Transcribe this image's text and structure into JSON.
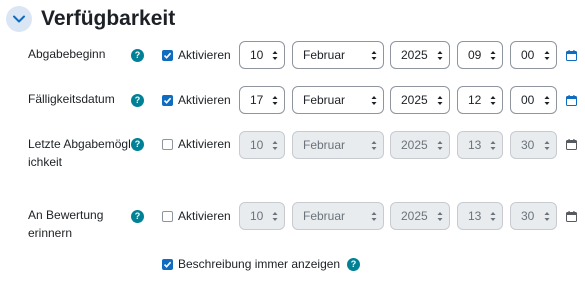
{
  "section": {
    "title": "Verfügbarkeit"
  },
  "rows": [
    {
      "label": "Abgabebeginn",
      "checkbox_label": "Aktivieren",
      "checked": true,
      "day": "10",
      "month": "Februar",
      "year": "2025",
      "hour": "09",
      "minute": "00"
    },
    {
      "label": "Fälligkeitsdatum",
      "checkbox_label": "Aktivieren",
      "checked": true,
      "day": "17",
      "month": "Februar",
      "year": "2025",
      "hour": "12",
      "minute": "00"
    },
    {
      "label": "Letzte Abgabemöglichkeit",
      "checkbox_label": "Aktivieren",
      "checked": false,
      "day": "10",
      "month": "Februar",
      "year": "2025",
      "hour": "13",
      "minute": "30"
    },
    {
      "label": "An Bewertung erinnern",
      "checkbox_label": "Aktivieren",
      "checked": false,
      "day": "10",
      "month": "Februar",
      "year": "2025",
      "hour": "13",
      "minute": "30"
    }
  ],
  "always_show": {
    "label": "Beschreibung immer anzeigen",
    "checked": true
  },
  "help_glyph": "?",
  "colors": {
    "accent": "#0f6cbf",
    "help": "#008196",
    "disabled_bg": "#e9ecef"
  }
}
